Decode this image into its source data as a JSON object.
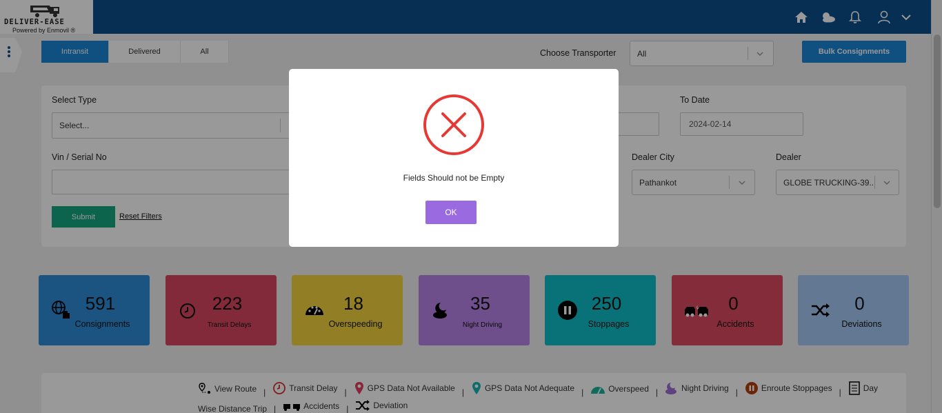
{
  "header": {
    "logo_text": "DELIVER-EASE",
    "logo_sub": "Powered by Enmovil ®",
    "icons": [
      "home-icon",
      "weather-icon",
      "bell-icon",
      "user-icon",
      "chevron-down-icon"
    ]
  },
  "tabs": [
    {
      "label": "Intransit",
      "active": true
    },
    {
      "label": "Delivered",
      "active": false
    },
    {
      "label": "All",
      "active": false
    }
  ],
  "transporter": {
    "label": "Choose Transporter",
    "value": "All"
  },
  "bulk_button": "Bulk Consignments",
  "filters": {
    "select_type": {
      "label": "Select Type",
      "value": "Select..."
    },
    "to_date": {
      "label": "To Date",
      "value": "2024-02-14"
    },
    "vin": {
      "label": "Vin / Serial No",
      "value": ""
    },
    "dealer_city": {
      "label": "Dealer City",
      "value": "Pathankot"
    },
    "dealer": {
      "label": "Dealer",
      "value": "GLOBE TRUCKING-39..."
    },
    "submit": "Submit",
    "reset": "Reset Filters"
  },
  "cards": [
    {
      "value": "591",
      "label": "Consignments",
      "color": "#2d8ad8",
      "icon": "globe-hand-icon"
    },
    {
      "value": "223",
      "label": "Transit Delays",
      "color": "#d9475f",
      "icon": "clock-icon"
    },
    {
      "value": "18",
      "label": "Overspeeding",
      "color": "#f3d43f",
      "icon": "speedometer-icon"
    },
    {
      "value": "35",
      "label": "Night Driving",
      "color": "#b783e8",
      "icon": "moon-cloud-icon"
    },
    {
      "value": "250",
      "label": "Stoppages",
      "color": "#10bcc8",
      "icon": "pause-circle-icon"
    },
    {
      "value": "0",
      "label": "Accidents",
      "color": "#dc4a5f",
      "icon": "car-crash-icon"
    },
    {
      "value": "0",
      "label": "Deviations",
      "color": "#a5c8f4",
      "icon": "shuffle-icon"
    }
  ],
  "legend": {
    "view_route": "View Route",
    "transit_delay": "Transit Delay",
    "gps_na": "GPS Data Not Available",
    "gps_nad": "GPS Data Not Adequate",
    "overspeed": "Overspeed",
    "night_driving": "Night Driving",
    "enroute": "Enroute Stoppages",
    "day_wise_1": "Day",
    "day_wise_2": "Wise Distance Trip",
    "accidents": "Accidents",
    "deviation": "Deviation",
    "separator": "|"
  },
  "modal": {
    "message": "Fields Should not be Empty",
    "ok": "OK",
    "icon": "error-x-icon",
    "icon_color": "#e53935"
  }
}
